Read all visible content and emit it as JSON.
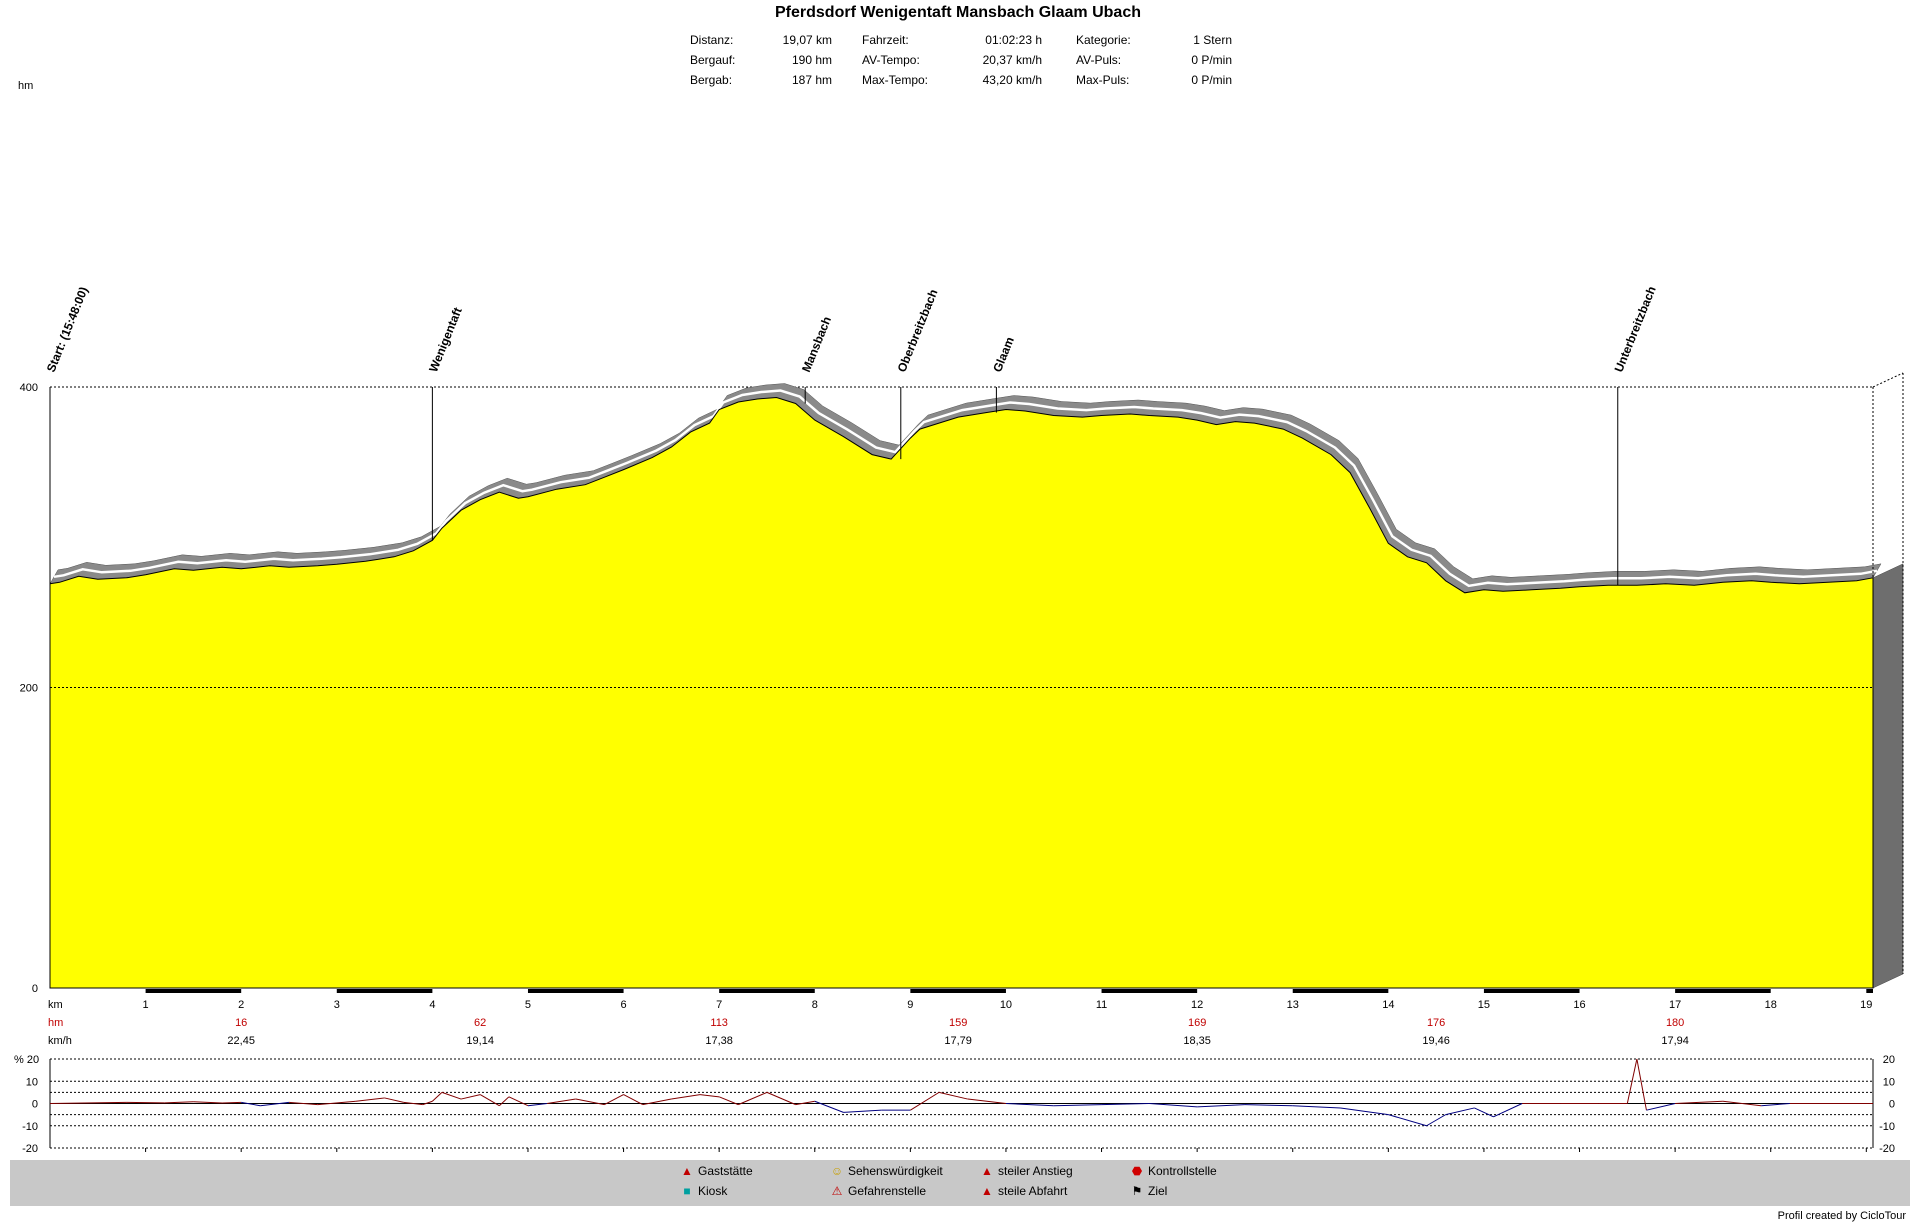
{
  "title": "Pferdsdorf Wenigentaft Mansbach Glaam Ubach",
  "stats": {
    "col1": [
      {
        "label": "Distanz:",
        "value": "19,07 km"
      },
      {
        "label": "Bergauf:",
        "value": "190 hm"
      },
      {
        "label": "Bergab:",
        "value": "187 hm"
      }
    ],
    "col2": [
      {
        "label": "Fahrzeit:",
        "value": "01:02:23 h"
      },
      {
        "label": "AV-Tempo:",
        "value": "20,37 km/h"
      },
      {
        "label": "Max-Tempo:",
        "value": "43,20 km/h"
      }
    ],
    "col3": [
      {
        "label": "Kategorie:",
        "value": "1 Stern"
      },
      {
        "label": "AV-Puls:",
        "value": "0 P/min"
      },
      {
        "label": "Max-Puls:",
        "value": "0 P/min"
      }
    ]
  },
  "chart_data": [
    {
      "type": "area",
      "title": "Pferdsdorf Wenigentaft Mansbach Glaam Ubach",
      "ylabel": "hm",
      "xlabel": "km",
      "ylim": [
        0,
        400
      ],
      "xlim": [
        0,
        19.07
      ],
      "yticks": [
        0,
        200,
        400
      ],
      "xticks": [
        1,
        2,
        3,
        4,
        5,
        6,
        7,
        8,
        9,
        10,
        11,
        12,
        13,
        14,
        15,
        16,
        17,
        18,
        19
      ],
      "grid": true,
      "fill_color": "#ffff00",
      "x": [
        0,
        0.1,
        0.3,
        0.5,
        0.8,
        1.0,
        1.3,
        1.5,
        1.8,
        2.0,
        2.3,
        2.5,
        2.8,
        3.0,
        3.3,
        3.6,
        3.8,
        4.0,
        4.1,
        4.3,
        4.5,
        4.7,
        4.9,
        5.0,
        5.3,
        5.6,
        5.8,
        6.0,
        6.3,
        6.5,
        6.7,
        6.9,
        7.0,
        7.2,
        7.4,
        7.6,
        7.8,
        8.0,
        8.3,
        8.6,
        8.8,
        9.0,
        9.1,
        9.3,
        9.5,
        9.8,
        10.0,
        10.2,
        10.5,
        10.8,
        11.0,
        11.3,
        11.5,
        11.8,
        12.0,
        12.2,
        12.4,
        12.6,
        12.9,
        13.1,
        13.4,
        13.6,
        13.8,
        14.0,
        14.2,
        14.4,
        14.6,
        14.8,
        15.0,
        15.2,
        15.5,
        15.8,
        16.0,
        16.3,
        16.6,
        16.9,
        17.2,
        17.5,
        17.8,
        18.0,
        18.3,
        18.6,
        18.9,
        19.07
      ],
      "y": [
        269,
        270,
        274,
        272,
        273,
        275,
        279,
        278,
        280,
        279,
        281,
        280,
        281,
        282,
        284,
        287,
        291,
        298,
        306,
        318,
        325,
        330,
        326,
        327,
        332,
        335,
        340,
        345,
        353,
        360,
        370,
        376,
        385,
        390,
        392,
        393,
        389,
        378,
        367,
        355,
        352,
        366,
        372,
        376,
        380,
        383,
        385,
        384,
        381,
        380,
        381,
        382,
        381,
        380,
        378,
        375,
        377,
        376,
        372,
        366,
        355,
        343,
        320,
        296,
        287,
        283,
        271,
        263,
        265,
        264,
        265,
        266,
        267,
        268,
        268,
        269,
        268,
        270,
        271,
        270,
        269,
        270,
        271,
        273
      ],
      "waypoints": [
        {
          "label": "Start: (15:48:00)",
          "km": 0
        },
        {
          "label": "Wenigentaft",
          "km": 4.0
        },
        {
          "label": "Mansbach",
          "km": 7.9
        },
        {
          "label": "Oberbreitzbach",
          "km": 8.9
        },
        {
          "label": "Glaam",
          "km": 9.9
        },
        {
          "label": "Unterbreitzbach",
          "km": 16.4
        }
      ],
      "cumulative": {
        "hm_label": "hm",
        "kmh_label": "km/h",
        "km_label": "km",
        "points": [
          {
            "km": 2.0,
            "hm": "16",
            "kmh": "22,45"
          },
          {
            "km": 4.5,
            "hm": "62",
            "kmh": "19,14"
          },
          {
            "km": 7.0,
            "hm": "113",
            "kmh": "17,38"
          },
          {
            "km": 9.5,
            "hm": "159",
            "kmh": "17,79"
          },
          {
            "km": 12.0,
            "hm": "169",
            "kmh": "18,35"
          },
          {
            "km": 14.5,
            "hm": "176",
            "kmh": "19,46"
          },
          {
            "km": 17.0,
            "hm": "180",
            "kmh": "17,94"
          }
        ]
      }
    },
    {
      "type": "line",
      "ylabel": "%",
      "ylim": [
        -20,
        20
      ],
      "yticks": [
        20,
        10,
        0,
        -10,
        -20
      ],
      "grid": true,
      "x": [
        0,
        0.8,
        1.2,
        1.5,
        1.8,
        2.0,
        2.2,
        2.5,
        2.8,
        3.2,
        3.5,
        3.7,
        3.9,
        4.0,
        4.1,
        4.3,
        4.5,
        4.7,
        4.8,
        5.0,
        5.2,
        5.5,
        5.8,
        6.0,
        6.2,
        6.5,
        6.8,
        7.0,
        7.2,
        7.5,
        7.8,
        8.0,
        8.3,
        8.7,
        9.0,
        9.3,
        9.6,
        10.0,
        10.5,
        11.0,
        11.5,
        12.0,
        12.5,
        13.0,
        13.5,
        14.0,
        14.4,
        14.6,
        14.9,
        15.1,
        15.4,
        15.8,
        16.2,
        16.5,
        16.6,
        16.7,
        17.0,
        17.5,
        17.9,
        18.2,
        18.5,
        19.07
      ],
      "values": [
        0,
        0.5,
        0.3,
        0.8,
        0.2,
        0.5,
        -1,
        0.5,
        -0.5,
        1,
        2.5,
        0.5,
        -0.5,
        1,
        5,
        2,
        4,
        -1,
        3,
        -1,
        0,
        2,
        -0.5,
        4,
        -0.5,
        2,
        4,
        3,
        -0.5,
        5,
        -0.5,
        1,
        -4,
        -3,
        -3,
        5,
        2,
        0,
        -1,
        -0.5,
        0,
        -1.5,
        -0.5,
        -1,
        -2,
        -5,
        -10,
        -5,
        -2,
        -6,
        0,
        0,
        0,
        0,
        20,
        -3,
        0,
        1,
        -1,
        0,
        0,
        0
      ],
      "series_colors": {
        "positive": "#800000",
        "negative": "#000080"
      }
    }
  ],
  "legend": [
    {
      "icon": "house-icon",
      "label": "Gaststätte"
    },
    {
      "icon": "kiosk-icon",
      "label": "Kiosk"
    },
    {
      "icon": "smiley-icon",
      "label": "Sehenswürdigkeit"
    },
    {
      "icon": "warning-icon",
      "label": "Gefahrenstelle"
    },
    {
      "icon": "steep-up-icon",
      "label": "steiler Anstieg"
    },
    {
      "icon": "steep-down-icon",
      "label": "steile Abfahrt"
    },
    {
      "icon": "stop-icon",
      "label": "Kontrollstelle"
    },
    {
      "icon": "finish-flag-icon",
      "label": "Ziel"
    }
  ],
  "footer": "Profil created by CicloTour"
}
